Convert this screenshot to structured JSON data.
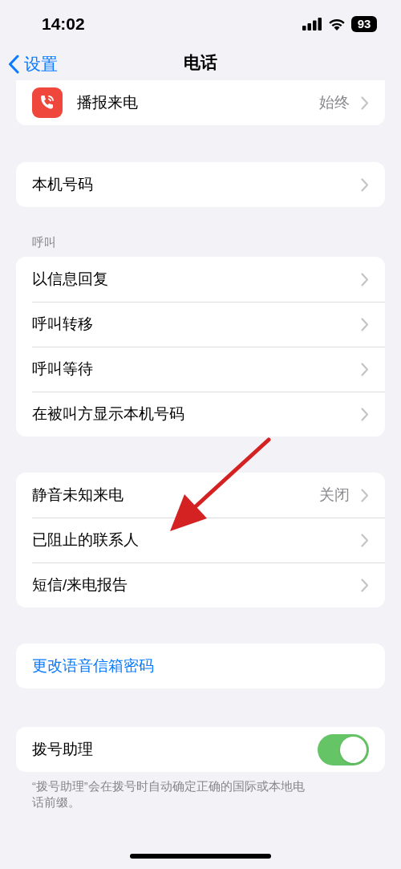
{
  "status_bar": {
    "time": "14:02",
    "battery": "93"
  },
  "nav": {
    "back": "设置",
    "title": "电话"
  },
  "groups": [
    {
      "cut_top": true,
      "rows": [
        {
          "kind": "icon-link",
          "label": "播报来电",
          "value": "始终"
        }
      ]
    },
    {
      "rows": [
        {
          "kind": "link",
          "label": "本机号码"
        }
      ]
    },
    {
      "header": "呼叫",
      "rows": [
        {
          "kind": "link",
          "label": "以信息回复"
        },
        {
          "kind": "link",
          "label": "呼叫转移"
        },
        {
          "kind": "link",
          "label": "呼叫等待"
        },
        {
          "kind": "link",
          "label": "在被叫方显示本机号码"
        }
      ]
    },
    {
      "rows": [
        {
          "kind": "link",
          "label": "静音未知来电",
          "value": "关闭"
        },
        {
          "kind": "link",
          "label": "已阻止的联系人"
        },
        {
          "kind": "link",
          "label": "短信/来电报告"
        }
      ]
    },
    {
      "rows": [
        {
          "kind": "action",
          "label": "更改语音信箱密码"
        }
      ]
    },
    {
      "rows": [
        {
          "kind": "toggle",
          "label": "拨号助理",
          "on": true
        }
      ],
      "footer": "“拨号助理”会在拨号时自动确定正确的国际或本地电话前缀。"
    }
  ]
}
